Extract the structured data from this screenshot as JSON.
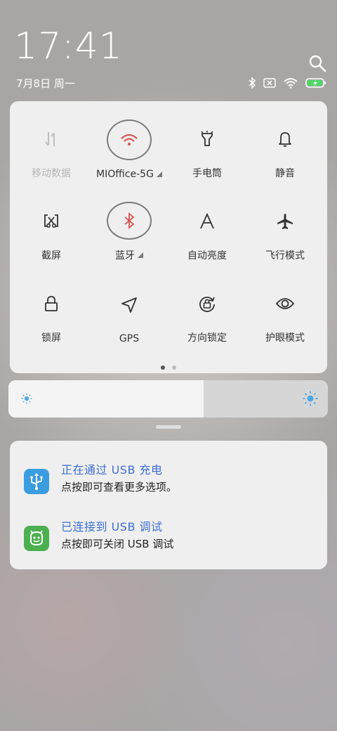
{
  "status": {
    "time": "17:41",
    "date": "7月8日 周一"
  },
  "quick_settings": {
    "tiles": [
      {
        "label": "移动数据",
        "icon": "mobile-data-icon",
        "state": "disabled"
      },
      {
        "label": "MIOffice-5G",
        "icon": "wifi-icon",
        "state": "on",
        "has_menu": true
      },
      {
        "label": "手电筒",
        "icon": "flashlight-icon",
        "state": "off"
      },
      {
        "label": "静音",
        "icon": "bell-icon",
        "state": "off"
      },
      {
        "label": "截屏",
        "icon": "screenshot-icon",
        "state": "off"
      },
      {
        "label": "蓝牙",
        "icon": "bluetooth-icon",
        "state": "on",
        "has_menu": true
      },
      {
        "label": "自动亮度",
        "icon": "auto-brightness-icon",
        "state": "off"
      },
      {
        "label": "飞行模式",
        "icon": "airplane-icon",
        "state": "off"
      },
      {
        "label": "锁屏",
        "icon": "lock-icon",
        "state": "off"
      },
      {
        "label": "GPS",
        "icon": "gps-icon",
        "state": "off"
      },
      {
        "label": "方向锁定",
        "icon": "rotation-lock-icon",
        "state": "off"
      },
      {
        "label": "护眼模式",
        "icon": "eye-icon",
        "state": "off"
      }
    ],
    "pager": {
      "current": 1,
      "total": 2
    }
  },
  "brightness": {
    "level": 0.61
  },
  "notifications": [
    {
      "title": "正在通过 USB 充电",
      "body": "点按即可查看更多选项。",
      "icon": "usb-icon",
      "icon_color": "#3a9de0"
    },
    {
      "title": "已连接到 USB 调试",
      "body": "点按即可关闭 USB 调试",
      "icon": "android-icon",
      "icon_color": "#4caf50"
    }
  ],
  "colors": {
    "accent_on": "#d9534f",
    "notification_title": "#3d6fd1",
    "slider_sun": "#4fa8e8"
  }
}
